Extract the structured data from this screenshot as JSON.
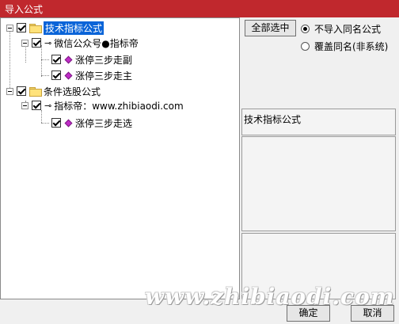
{
  "window": {
    "title": "导入公式"
  },
  "tree": [
    {
      "label": "技术指标公式",
      "checked": true,
      "selected": true,
      "icon": "folder-icon"
    },
    {
      "label": "微信公众号●指标帝",
      "checked": true,
      "icon": "key-icon"
    },
    {
      "label": "涨停三步走副",
      "checked": true,
      "icon": "formula-gem-icon"
    },
    {
      "label": "涨停三步走主",
      "checked": true,
      "icon": "formula-gem-icon"
    },
    {
      "label": "条件选股公式",
      "checked": true,
      "icon": "folder-icon"
    },
    {
      "label": "指标帝：www.zhibiaodi.com",
      "checked": true,
      "icon": "key-icon"
    },
    {
      "label": "涨停三步走选",
      "checked": true,
      "icon": "formula-gem-icon"
    }
  ],
  "right": {
    "select_all_label": "全部选中",
    "radio_skip_label": "不导入同名公式",
    "radio_overwrite_label": "覆盖同名(非系统)",
    "radio_selected": "skip",
    "info_label": "技术指标公式"
  },
  "footer": {
    "ok_label": "确定",
    "cancel_label": "取消"
  },
  "watermark": "www.zhibiaodi.com"
}
